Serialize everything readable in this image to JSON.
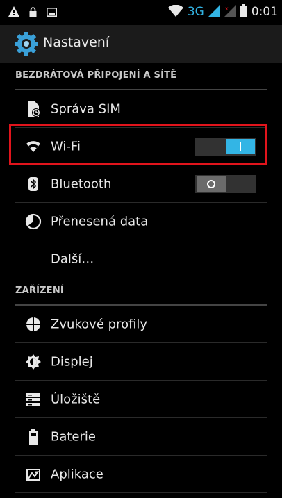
{
  "status_bar": {
    "network_type": "3G",
    "time": "0:01",
    "icons": [
      "warning-icon",
      "lock-icon",
      "image-icon",
      "wifi-icon",
      "signal-icon",
      "no-signal-icon",
      "battery-icon"
    ]
  },
  "action_bar": {
    "title": "Nastavení",
    "icon": "settings-gear-icon"
  },
  "sections": [
    {
      "label": "BEZDRÁTOVÁ PŘIPOJENÍ A SÍTĚ",
      "items": [
        {
          "label": "Správa SIM",
          "icon": "sim-icon"
        },
        {
          "label": "Wi-Fi",
          "icon": "wifi-icon",
          "toggle": "on"
        },
        {
          "label": "Bluetooth",
          "icon": "bluetooth-icon",
          "toggle": "off"
        },
        {
          "label": "Přenesená data",
          "icon": "data-usage-icon"
        },
        {
          "label": "Další…",
          "icon": ""
        }
      ]
    },
    {
      "label": "ZAŘÍZENÍ",
      "items": [
        {
          "label": "Zvukové profily",
          "icon": "audio-profiles-icon"
        },
        {
          "label": "Displej",
          "icon": "display-icon"
        },
        {
          "label": "Úložiště",
          "icon": "storage-icon"
        },
        {
          "label": "Baterie",
          "icon": "battery-icon"
        },
        {
          "label": "Aplikace",
          "icon": "apps-icon"
        }
      ]
    }
  ],
  "colors": {
    "accent": "#33b5e5",
    "highlight": "#e1141c",
    "background": "#000000",
    "action_bar": "#1b1b1b"
  }
}
